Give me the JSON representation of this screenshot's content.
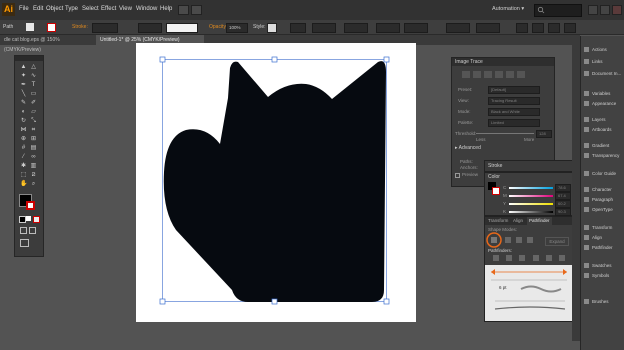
{
  "app": {
    "logo": "Ai"
  },
  "menu": [
    "File",
    "Edit",
    "Object",
    "Type",
    "Select",
    "Effect",
    "View",
    "Window",
    "Help"
  ],
  "workspace": {
    "label": "Automation",
    "chevron": "▾"
  },
  "control_bar": {
    "path_label": "Path",
    "stroke_label": "Stroke:",
    "opacity_label": "Opacity:",
    "opacity_value": "100%",
    "style_label": "Style:"
  },
  "tabs": [
    {
      "label": "dle cat blog.eps @ 150% (CMYK/Preview)",
      "active": false
    },
    {
      "label": "Untitled-1* @ 25% (CMYK/Preview)",
      "active": true
    }
  ],
  "image_trace": {
    "title": "Image Trace",
    "rows": [
      {
        "label": "Preset:",
        "value": "[Default]"
      },
      {
        "label": "View:",
        "value": "Tracing Result"
      },
      {
        "label": "Mode:",
        "value": "Black and White"
      },
      {
        "label": "Palette:",
        "value": "Limited"
      }
    ],
    "threshold_label": "Threshold:",
    "threshold_value": "128",
    "less": "Less",
    "more": "More",
    "advanced": "Advanced",
    "paths_label": "Paths:",
    "anchors_label": "Anchors:",
    "preview_label": "Preview"
  },
  "stroke_panel": {
    "title": "Stroke"
  },
  "color_panel": {
    "title": "Color",
    "channels": [
      "C",
      "M",
      "Y",
      "K"
    ],
    "values": [
      "78.6",
      "67.4",
      "60.2",
      "90.3"
    ]
  },
  "pathfinder_panel": {
    "tabs": [
      "Transform",
      "Align",
      "Pathfinder"
    ],
    "shape_modes": "Shape Modes:",
    "pathfinders": "Pathfinders:",
    "expand": "Expand",
    "stroke_weight": "6 pt"
  },
  "dock": [
    "Actions",
    "Links",
    "Document In...",
    "Variables",
    "Appearance",
    "Layers",
    "Artboards",
    "Gradient",
    "Transparency",
    "Color Guide",
    "Character",
    "Paragraph",
    "OpenType",
    "Transform",
    "Align",
    "Pathfinder",
    "Swatches",
    "Symbols",
    "Brushes"
  ],
  "colors": {
    "accent": "#ff9a00",
    "highlight_ring": "#e8681a",
    "shape_fill": "#060a10"
  }
}
